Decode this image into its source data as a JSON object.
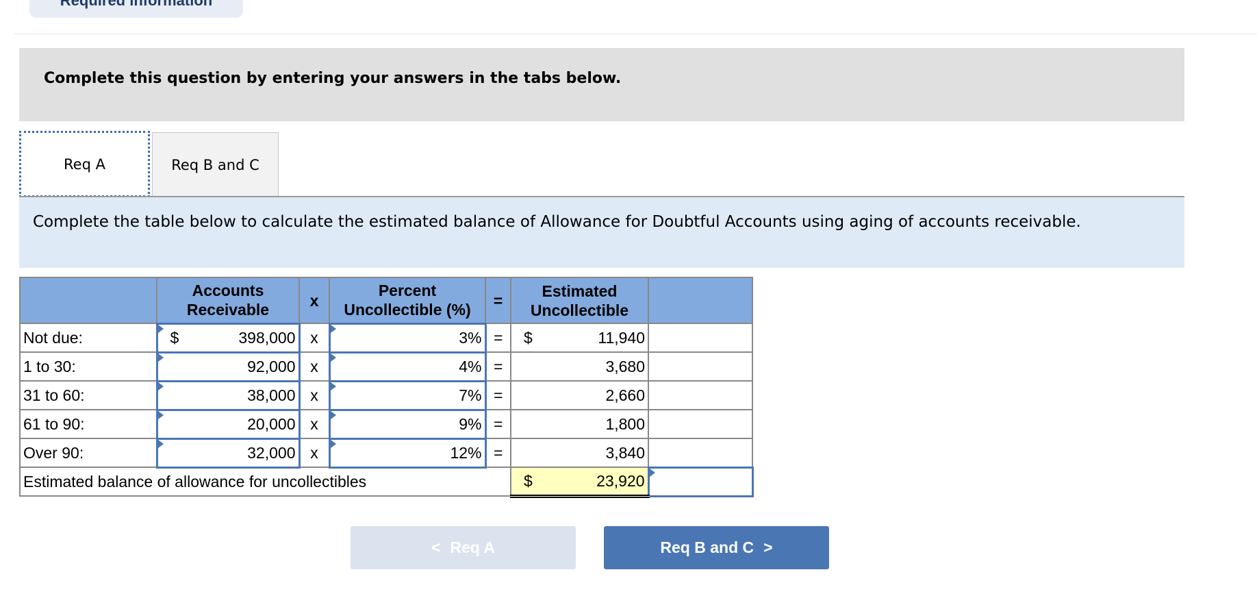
{
  "header_tab": "Required information",
  "instructions": "Complete this question by entering your answers in the tabs below.",
  "tabs": [
    {
      "label": "Req A",
      "active": true
    },
    {
      "label": "Req B and C",
      "active": false
    }
  ],
  "prompt": "Complete the table below to calculate the estimated balance of Allowance for Doubtful Accounts using aging of accounts receivable.",
  "table": {
    "headers": {
      "accounts_receivable": "Accounts Receivable",
      "times": "x",
      "percent": "Percent Uncollectible (%)",
      "equals": "=",
      "estimated": "Estimated Uncollectible"
    },
    "currency": "$",
    "rows": [
      {
        "label": "Not due:",
        "ar": "398,000",
        "x": "x",
        "pct": "3%",
        "eq": "=",
        "est": "11,940"
      },
      {
        "label": "1 to 30:",
        "ar": "92,000",
        "x": "x",
        "pct": "4%",
        "eq": "=",
        "est": "3,680"
      },
      {
        "label": "31 to 60:",
        "ar": "38,000",
        "x": "x",
        "pct": "7%",
        "eq": "=",
        "est": "2,660"
      },
      {
        "label": "61 to 90:",
        "ar": "20,000",
        "x": "x",
        "pct": "9%",
        "eq": "=",
        "est": "1,800"
      },
      {
        "label": "Over 90:",
        "ar": "32,000",
        "x": "x",
        "pct": "12%",
        "eq": "=",
        "est": "3,840"
      }
    ],
    "total_label": "Estimated balance of allowance for uncollectibles",
    "total_value": "23,920"
  },
  "nav": {
    "prev_label": "Req A",
    "next_label": "Req B and C",
    "prev_icon": "chevron-left-icon",
    "next_icon": "chevron-right-icon"
  },
  "colors": {
    "header_blue": "#82aade",
    "button_blue": "#4a76b4",
    "total_yellow": "#ffffc0"
  }
}
